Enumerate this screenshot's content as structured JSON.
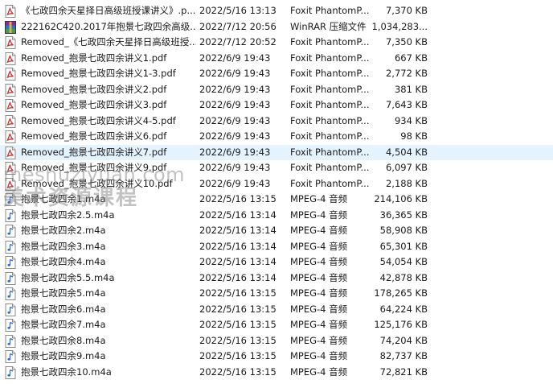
{
  "files": [
    {
      "icon": "pdf-file-icon",
      "name": "《七政四余天星择日高级班授课讲义》.p...",
      "date": "2022/5/16 13:13",
      "type": "Foxit PhantomP...",
      "size": "7,370 KB"
    },
    {
      "icon": "rar-archive-icon",
      "name": "222162C420.2017年抱景七政四余高级...",
      "date": "2022/7/12 20:56",
      "type": "WinRAR 压缩文件",
      "size": "1,034,283..."
    },
    {
      "icon": "pdf-file-icon",
      "name": "Removed_《七政四余天星择日高级班授...",
      "date": "2022/7/12 20:52",
      "type": "Foxit PhantomP...",
      "size": "7,350 KB"
    },
    {
      "icon": "pdf-file-icon",
      "name": "Removed_抱景七政四余讲义1.pdf",
      "date": "2022/6/9 19:43",
      "type": "Foxit PhantomP...",
      "size": "667 KB"
    },
    {
      "icon": "pdf-file-icon",
      "name": "Removed_抱景七政四余讲义1-3.pdf",
      "date": "2022/6/9 19:43",
      "type": "Foxit PhantomP...",
      "size": "2,772 KB"
    },
    {
      "icon": "pdf-file-icon",
      "name": "Removed_抱景七政四余讲义2.pdf",
      "date": "2022/6/9 19:43",
      "type": "Foxit PhantomP...",
      "size": "381 KB"
    },
    {
      "icon": "pdf-file-icon",
      "name": "Removed_抱景七政四余讲义3.pdf",
      "date": "2022/6/9 19:43",
      "type": "Foxit PhantomP...",
      "size": "7,643 KB"
    },
    {
      "icon": "pdf-file-icon",
      "name": "Removed_抱景七政四余讲义4-5.pdf",
      "date": "2022/6/9 19:43",
      "type": "Foxit PhantomP...",
      "size": "934 KB"
    },
    {
      "icon": "pdf-file-icon",
      "name": "Removed_抱景七政四余讲义6.pdf",
      "date": "2022/6/9 19:43",
      "type": "Foxit PhantomP...",
      "size": "98 KB"
    },
    {
      "icon": "pdf-file-icon",
      "name": "Removed_抱景七政四余讲义7.pdf",
      "date": "2022/6/9 19:43",
      "type": "Foxit PhantomP...",
      "size": "4,504 KB",
      "selected": true
    },
    {
      "icon": "pdf-file-icon",
      "name": "Removed_抱景七政四余讲义9.pdf",
      "date": "2022/6/9 19:43",
      "type": "Foxit PhantomP...",
      "size": "6,097 KB"
    },
    {
      "icon": "pdf-file-icon",
      "name": "Removed_抱景七政四余讲义10.pdf",
      "date": "2022/6/9 19:43",
      "type": "Foxit PhantomP...",
      "size": "2,188 KB"
    },
    {
      "icon": "audio-file-icon",
      "name": "抱景七政四余1.m4a",
      "date": "2022/5/16 13:15",
      "type": "MPEG-4 音频",
      "size": "214,106 KB"
    },
    {
      "icon": "audio-file-icon",
      "name": "抱景七政四余2.5.m4a",
      "date": "2022/5/16 13:14",
      "type": "MPEG-4 音频",
      "size": "36,365 KB"
    },
    {
      "icon": "audio-file-icon",
      "name": "抱景七政四余2.m4a",
      "date": "2022/5/16 13:14",
      "type": "MPEG-4 音频",
      "size": "58,908 KB"
    },
    {
      "icon": "audio-file-icon",
      "name": "抱景七政四余3.m4a",
      "date": "2022/5/16 13:14",
      "type": "MPEG-4 音频",
      "size": "65,301 KB"
    },
    {
      "icon": "audio-file-icon",
      "name": "抱景七政四余4.m4a",
      "date": "2022/5/16 13:14",
      "type": "MPEG-4 音频",
      "size": "54,054 KB"
    },
    {
      "icon": "audio-file-icon",
      "name": "抱景七政四余5.5.m4a",
      "date": "2022/5/16 13:14",
      "type": "MPEG-4 音频",
      "size": "42,878 KB"
    },
    {
      "icon": "audio-file-icon",
      "name": "抱景七政四余5.m4a",
      "date": "2022/5/16 13:15",
      "type": "MPEG-4 音频",
      "size": "178,265 KB"
    },
    {
      "icon": "audio-file-icon",
      "name": "抱景七政四余6.m4a",
      "date": "2022/5/16 13:15",
      "type": "MPEG-4 音频",
      "size": "64,224 KB"
    },
    {
      "icon": "audio-file-icon",
      "name": "抱景七政四余7.m4a",
      "date": "2022/5/16 13:15",
      "type": "MPEG-4 音频",
      "size": "125,176 KB"
    },
    {
      "icon": "audio-file-icon",
      "name": "抱景七政四余8.m4a",
      "date": "2022/5/16 13:15",
      "type": "MPEG-4 音频",
      "size": "74,204 KB"
    },
    {
      "icon": "audio-file-icon",
      "name": "抱景七政四余9.m4a",
      "date": "2022/5/16 13:15",
      "type": "MPEG-4 音频",
      "size": "82,737 KB"
    },
    {
      "icon": "audio-file-icon",
      "name": "抱景七政四余10.m4a",
      "date": "2022/5/16 13:15",
      "type": "MPEG-4 音频",
      "size": "72,821 KB"
    }
  ],
  "watermark": {
    "url": "meshuziyuan.com",
    "text": "美术资源课程"
  },
  "colors": {
    "selected_row": "#e5f3ff",
    "pdf_red": "#d0312d",
    "audio_blue": "#2f6fd0"
  }
}
